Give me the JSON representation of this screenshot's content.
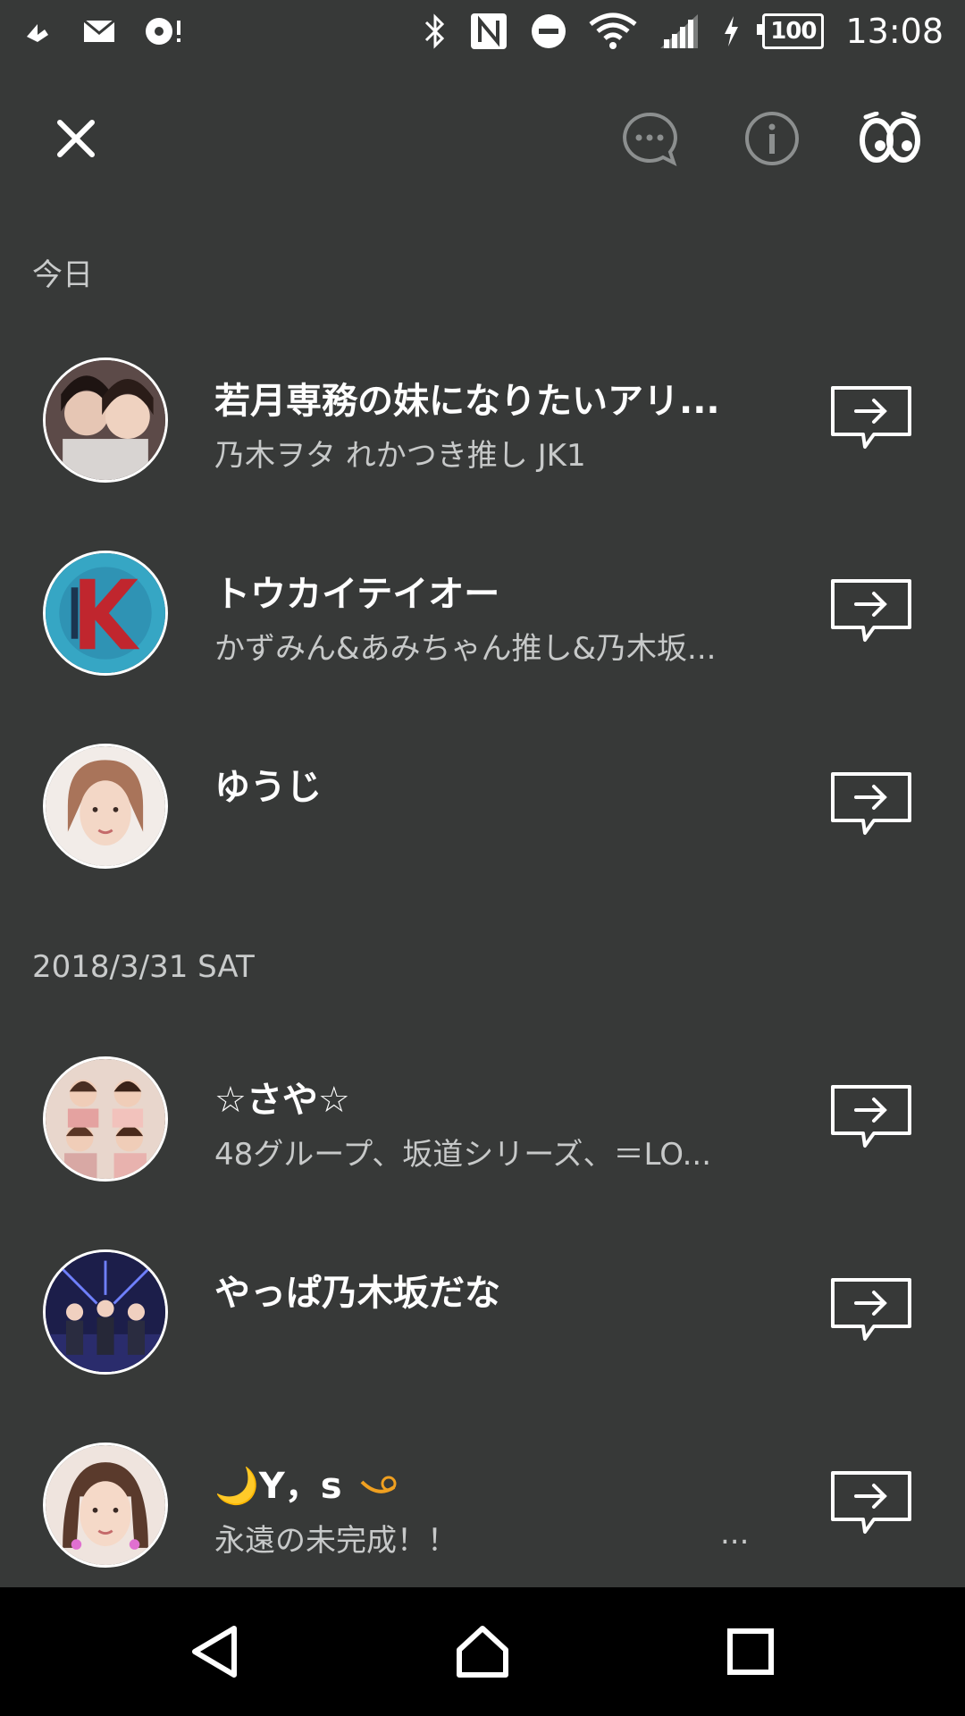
{
  "status_bar": {
    "battery_level": "100",
    "time": "13:08",
    "icons": [
      "music-share-icon",
      "mail-icon",
      "disc-alert-icon",
      "bluetooth-icon",
      "nfc-icon",
      "do-not-disturb-icon",
      "wifi-icon",
      "signal-icon",
      "charging-icon"
    ]
  },
  "toolbar": {
    "icons": [
      "close-icon",
      "chat-bubble-icon",
      "info-icon",
      "eyes-icon"
    ]
  },
  "sections": [
    {
      "label": "今日"
    },
    {
      "label": "2018/3/31 SAT"
    }
  ],
  "contacts": [
    {
      "name": "若月専務の妹になりたいアリ...",
      "status": "乃木ヲタ  れかつき推し  JK1"
    },
    {
      "name": "トウカイテイオー",
      "status": "かずみん&あみちゃん推し&乃木坂..."
    },
    {
      "name": "ゆうじ",
      "status": ""
    },
    {
      "name": "☆さや☆",
      "status": "48グループ、坂道シリーズ、＝LO..."
    },
    {
      "name": "やっぱ乃木坂だな",
      "status": ""
    },
    {
      "name": "🌙Y，s",
      "status": "永遠の未完成！！",
      "status_tail": "..."
    }
  ],
  "colors": {
    "background": "#373938",
    "nav_background": "#000000",
    "text_primary": "#ffffff",
    "text_secondary": "#c7c9c9",
    "accent_orange": "#f0a020"
  }
}
